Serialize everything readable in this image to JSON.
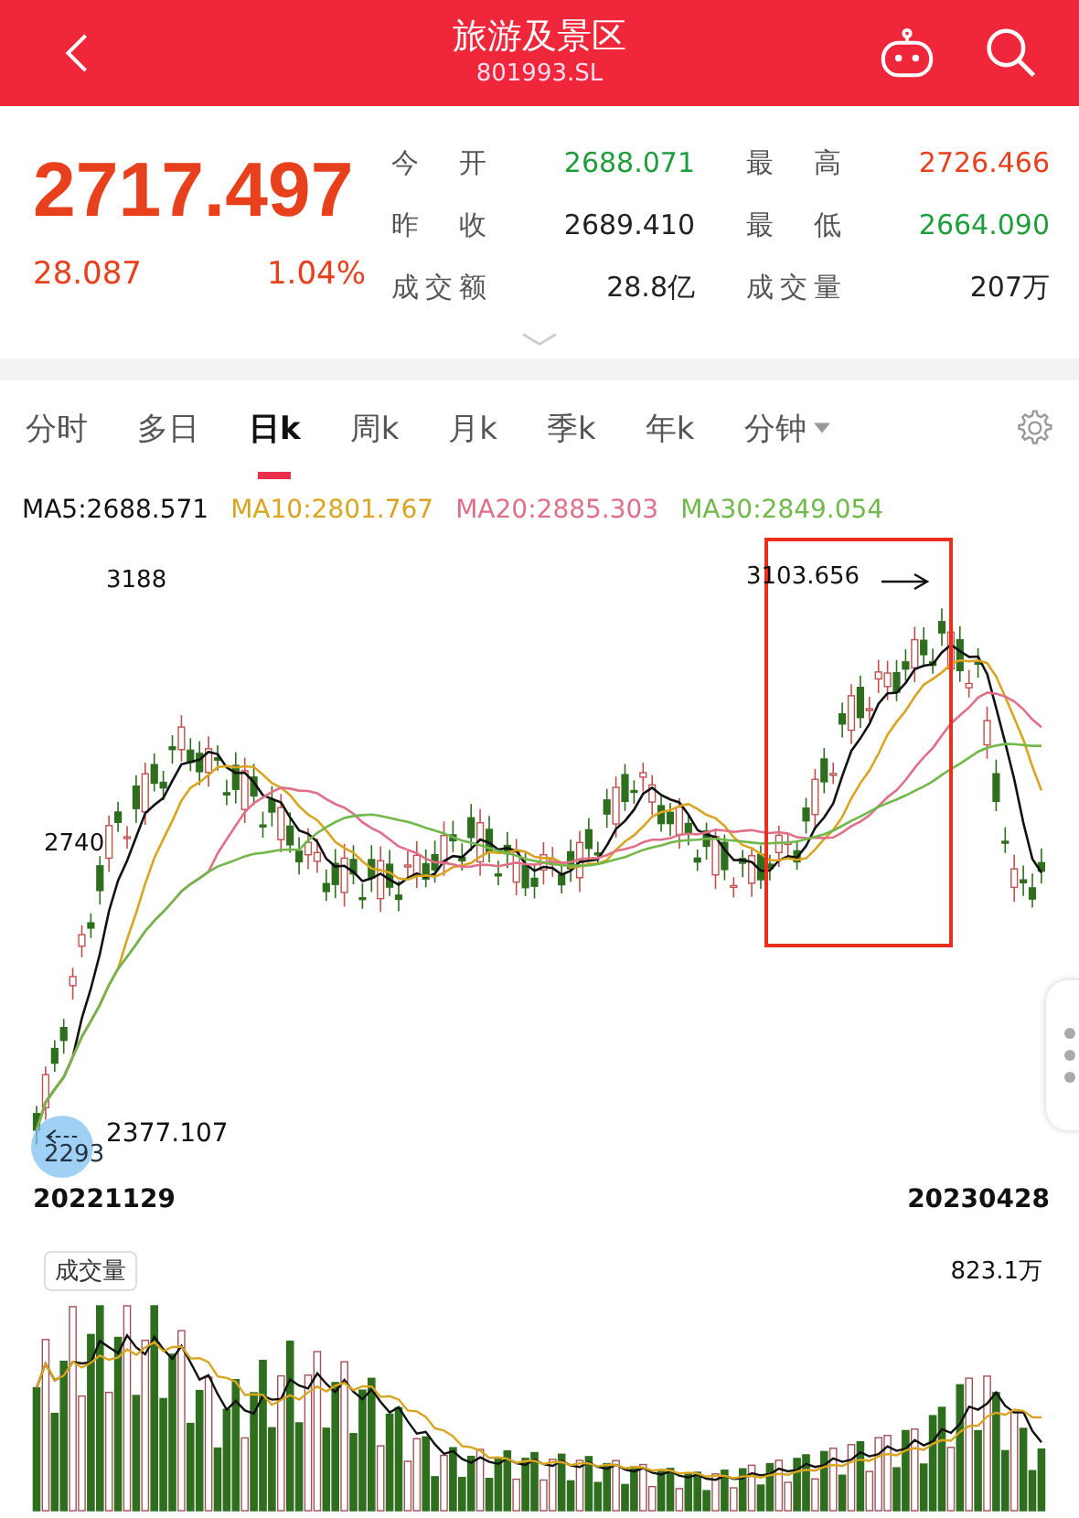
{
  "header": {
    "title": "旅游及景区",
    "code": "801993.SL"
  },
  "quote": {
    "price": "2717.497",
    "change": "28.087",
    "change_pct": "1.04%"
  },
  "stats": [
    {
      "label": "今开",
      "value": "2688.071",
      "color": "#1e9e3a"
    },
    {
      "label": "最高",
      "value": "2726.466",
      "color": "#e8401c"
    },
    {
      "label": "昨收",
      "value": "2689.410",
      "color": "#222222"
    },
    {
      "label": "最低",
      "value": "2664.090",
      "color": "#1e9e3a"
    },
    {
      "label": "成交额",
      "value": "28.8亿",
      "color": "#222222"
    },
    {
      "label": "成交量",
      "value": "207万",
      "color": "#222222"
    }
  ],
  "tabs": [
    {
      "label": "分时",
      "selected": false,
      "kind": "plain"
    },
    {
      "label": "多日",
      "selected": false,
      "kind": "plain"
    },
    {
      "label": "日k",
      "selected": true,
      "kind": "plain"
    },
    {
      "label": "周k",
      "selected": false,
      "kind": "plain"
    },
    {
      "label": "月k",
      "selected": false,
      "kind": "plain"
    },
    {
      "label": "季k",
      "selected": false,
      "kind": "plain"
    },
    {
      "label": "年k",
      "selected": false,
      "kind": "plain"
    },
    {
      "label": "分钟",
      "selected": false,
      "kind": "dropdown"
    }
  ],
  "ma_legend": [
    {
      "label": "MA5:2688.571",
      "color": "#111111"
    },
    {
      "label": "MA10:2801.767",
      "color": "#d9a520"
    },
    {
      "label": "MA20:2885.303",
      "color": "#e07088"
    },
    {
      "label": "MA30:2849.054",
      "color": "#70b84a"
    }
  ],
  "chart": {
    "top_label": "3188",
    "mid_label": "2740",
    "bottom_label": "2293",
    "high_mark": "3103.656",
    "low_mark": "2377.107",
    "start_date": "20221129",
    "end_date": "20230428"
  },
  "volume": {
    "label": "成交量",
    "max_label": "823.1万"
  }
}
